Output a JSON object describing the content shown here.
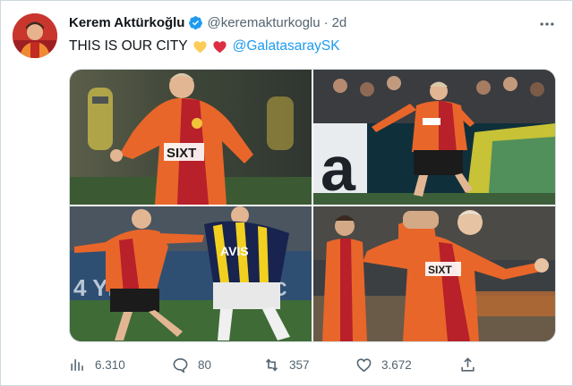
{
  "tweet": {
    "author_name": "Kerem Aktürkoğlu",
    "author_handle": "@keremakturkoglu",
    "separator": "·",
    "time": "2d",
    "text": "THIS IS OUR CITY",
    "emojis": [
      "yellow-heart",
      "red-heart"
    ],
    "mention": "@GalatasaraySK",
    "jersey_sponsor": "SIXT"
  },
  "actions": {
    "views": "6.310",
    "replies": "80",
    "retweets": "357",
    "likes": "3.672"
  },
  "icons": {
    "verified": "verified-badge-icon",
    "more": "more-options-icon",
    "views": "bar-chart-icon",
    "reply": "reply-icon",
    "retweet": "retweet-icon",
    "like": "heart-icon",
    "share": "share-icon"
  },
  "colors": {
    "accent_blue": "#1d9bf0",
    "muted_text": "#536471",
    "jersey_orange": "#e8662a",
    "jersey_red": "#b8202a",
    "rival_yellow": "#f2d020",
    "rival_navy": "#18234f"
  }
}
